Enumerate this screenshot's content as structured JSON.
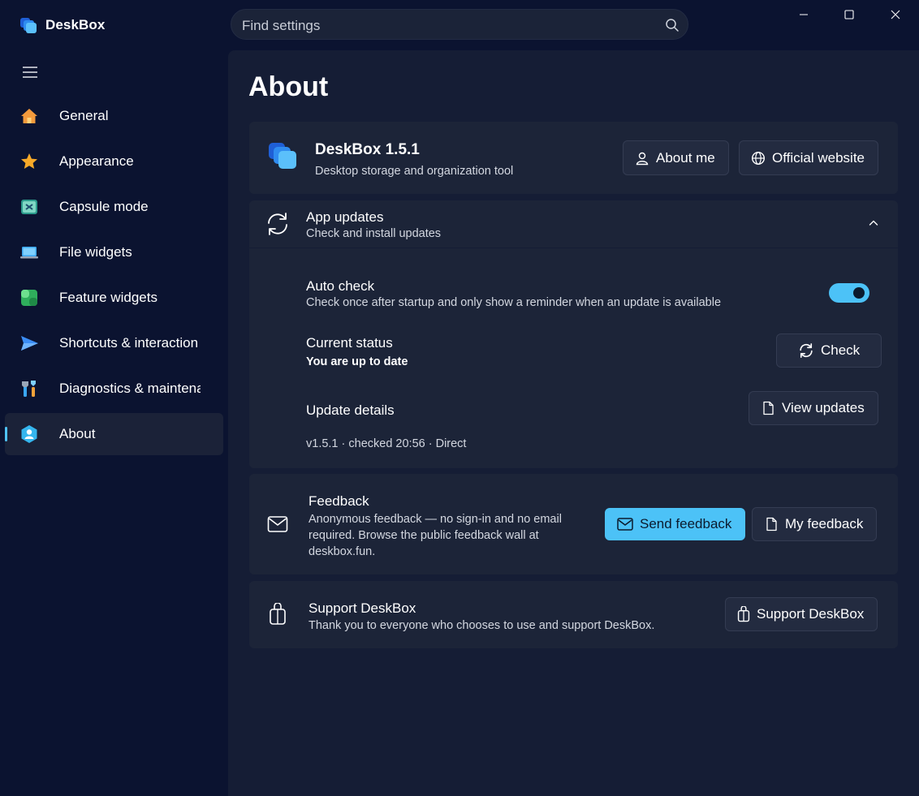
{
  "app": {
    "title": "DeskBox"
  },
  "search": {
    "placeholder": "Find settings"
  },
  "sidebar": {
    "items": [
      {
        "label": "General",
        "icon": "home-icon"
      },
      {
        "label": "Appearance",
        "icon": "star-icon"
      },
      {
        "label": "Capsule mode",
        "icon": "capsule-icon"
      },
      {
        "label": "File widgets",
        "icon": "laptop-icon"
      },
      {
        "label": "Feature widgets",
        "icon": "widgets-icon"
      },
      {
        "label": "Shortcuts & interaction",
        "icon": "send-icon"
      },
      {
        "label": "Diagnostics & maintenance",
        "icon": "tools-icon"
      },
      {
        "label": "About",
        "icon": "about-icon",
        "active": true
      }
    ]
  },
  "main": {
    "title": "About",
    "app_card": {
      "name": "DeskBox 1.5.1",
      "description": "Desktop storage and organization tool",
      "about_me_label": "About me",
      "website_label": "Official website"
    },
    "updates": {
      "title": "App updates",
      "subtitle": "Check and install updates",
      "auto_check": {
        "title": "Auto check",
        "description": "Check once after startup and only show a reminder when an update is available",
        "enabled": true
      },
      "status": {
        "title": "Current status",
        "value": "You are up to date",
        "check_label": "Check"
      },
      "details": {
        "title": "Update details",
        "view_label": "View updates",
        "info": "v1.5.1 · checked 20:56 · Direct"
      }
    },
    "feedback": {
      "title": "Feedback",
      "description": "Anonymous feedback — no sign-in and no email required. Browse the public feedback wall at deskbox.fun.",
      "send_label": "Send feedback",
      "mine_label": "My feedback"
    },
    "support": {
      "title": "Support DeskBox",
      "description": "Thank you to everyone who chooses to use and support DeskBox.",
      "button_label": "Support DeskBox"
    }
  },
  "colors": {
    "accent": "#4cc2f7",
    "background": "#0b1330",
    "panel": "#151d35",
    "card": "#1c2438"
  }
}
